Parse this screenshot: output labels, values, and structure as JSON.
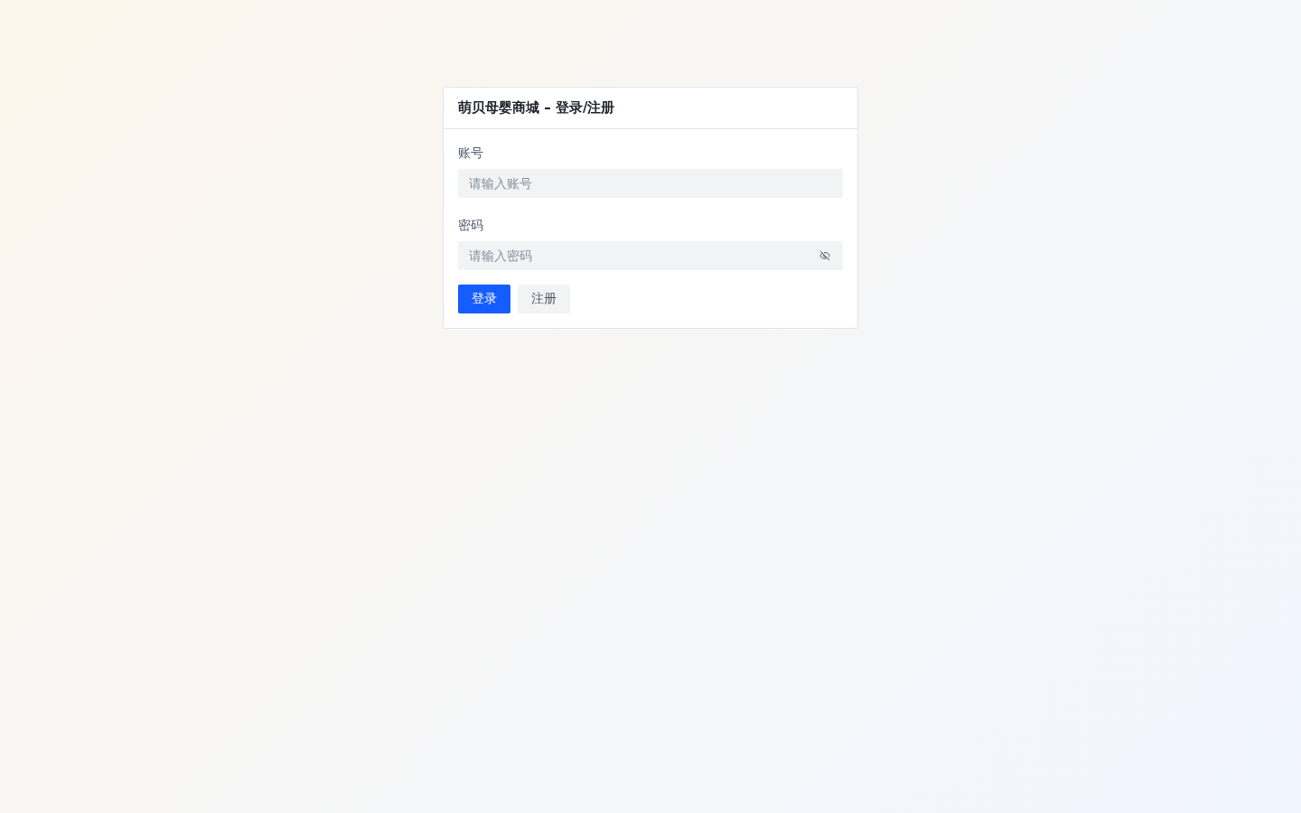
{
  "card": {
    "title": "萌贝母婴商城 – 登录/注册"
  },
  "fields": [
    {
      "label": "账号",
      "placeholder": "请输入账号",
      "kind": "text"
    },
    {
      "label": "密码",
      "placeholder": "请输入密码",
      "kind": "password",
      "revealed": false
    }
  ],
  "buttons": [
    {
      "label": "登录",
      "kind": "primary"
    },
    {
      "label": "注册",
      "kind": "secondary"
    }
  ]
}
